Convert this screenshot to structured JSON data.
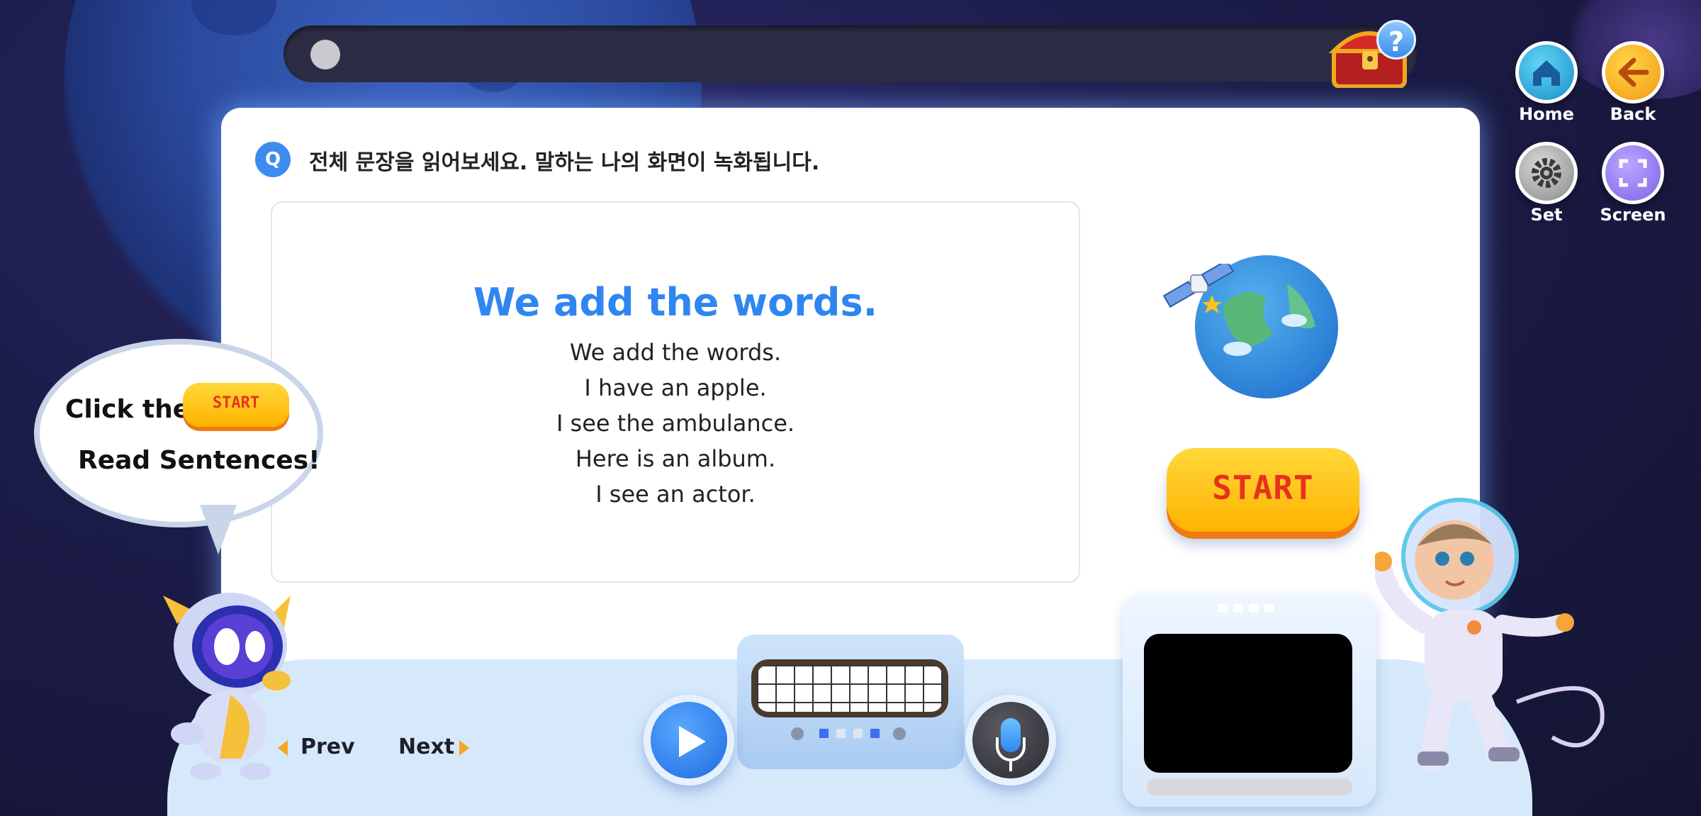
{
  "header": {
    "progress_fraction": 0.0,
    "help_badge": "?"
  },
  "controls": {
    "home_label": "Home",
    "back_label": "Back",
    "set_label": "Set",
    "screen_label": "Screen"
  },
  "question": {
    "badge": "Q",
    "instruction": "전체 문장을 읽어보세요. 말하는 나의 화면이 녹화됩니다."
  },
  "card": {
    "title": "We add the words.",
    "sentences": [
      "We add the words.",
      "I have an apple.",
      "I see the ambulance.",
      "Here is an album.",
      "I see an actor."
    ]
  },
  "start_button_label": "START",
  "bubble": {
    "line1": "Click the",
    "start_label": "START",
    "line2": "Read Sentences!"
  },
  "nav": {
    "prev_label": "Prev",
    "next_label": "Next"
  },
  "colors": {
    "accent_blue": "#2f86f0",
    "start_yellow": "#ffc21a",
    "start_text": "#e8321d",
    "nav_arrow": "#f5a623"
  },
  "icons": {
    "home": "home-icon",
    "back": "arrow-left-icon",
    "set": "gear-icon",
    "screen": "fullscreen-icon",
    "play": "play-icon",
    "mic": "microphone-icon"
  }
}
